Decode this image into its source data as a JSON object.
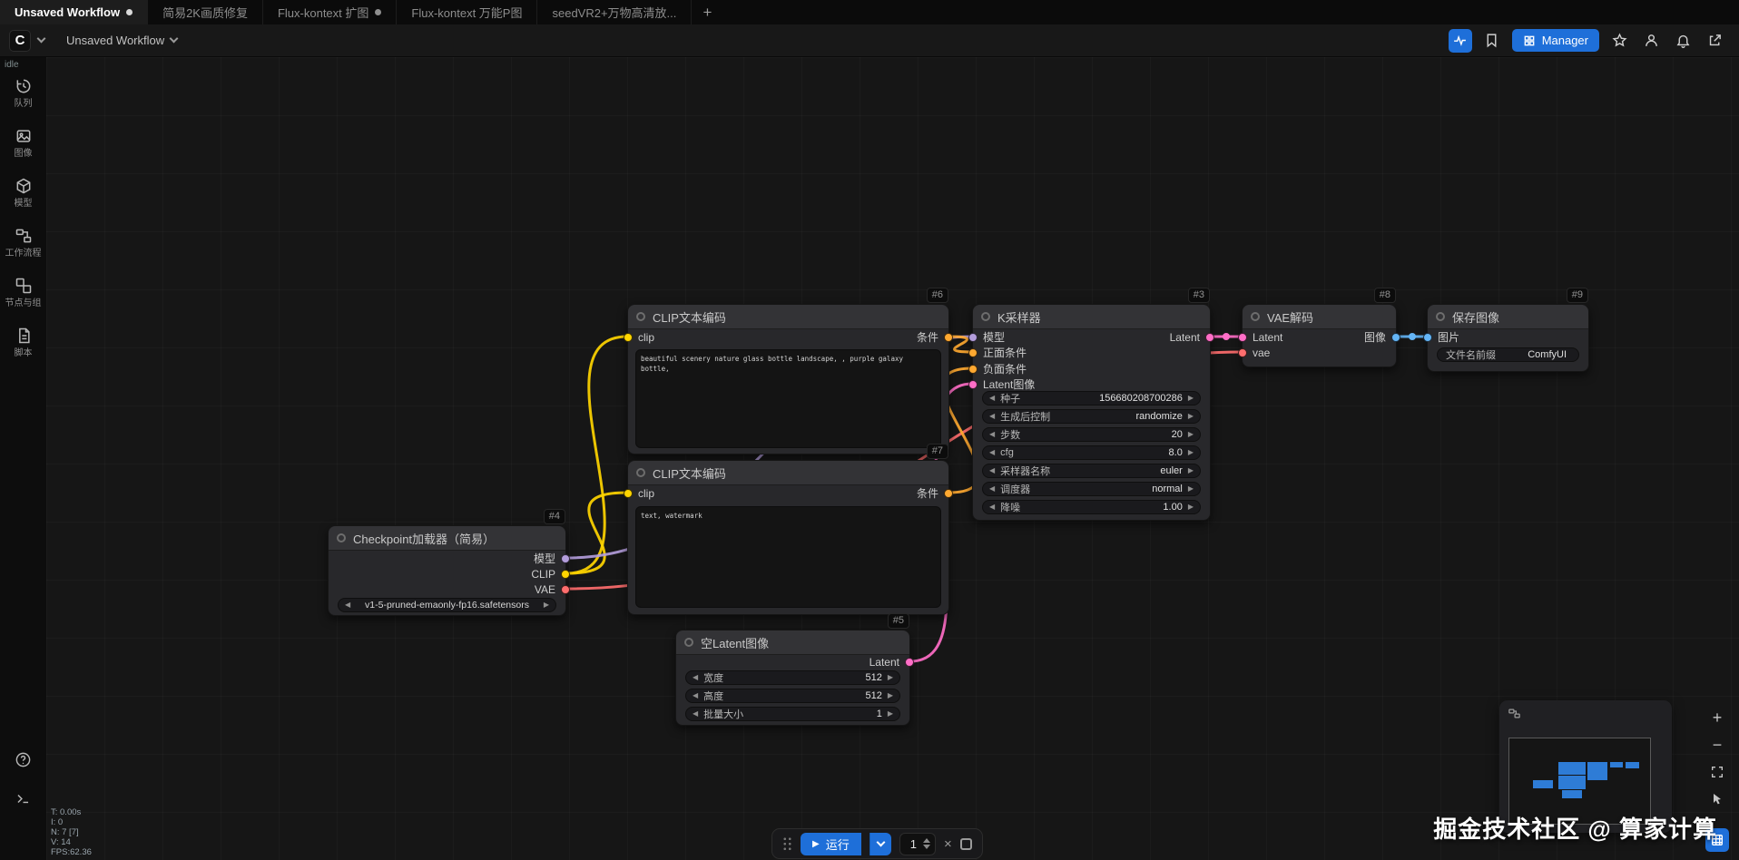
{
  "tabbar": {
    "tabs": [
      {
        "label": "Unsaved Workflow",
        "active": true,
        "dot": true
      },
      {
        "label": "简易2K画质修复",
        "active": false,
        "dot": false
      },
      {
        "label": "Flux-kontext 扩图",
        "active": false,
        "dot": true
      },
      {
        "label": "Flux-kontext 万能P图",
        "active": false,
        "dot": false
      },
      {
        "label": "seedVR2+万物高清放...",
        "active": false,
        "dot": false
      }
    ],
    "new_tab_label": "+"
  },
  "menubar": {
    "workflow_name": "Unsaved Workflow",
    "manager_label": "Manager",
    "status": "idle"
  },
  "sidebar": {
    "items": [
      {
        "label": "队列"
      },
      {
        "label": "图像"
      },
      {
        "label": "模型"
      },
      {
        "label": "工作流程"
      },
      {
        "label": "节点与组"
      },
      {
        "label": "脚本"
      }
    ]
  },
  "canvas_stats": {
    "lines": [
      "T: 0.00s",
      "I: 0",
      "N: 7 [7]",
      "V: 14",
      "FPS:62.36"
    ]
  },
  "nodes": {
    "checkpoint": {
      "badge": "#4",
      "title": "Checkpoint加载器（简易）",
      "outputs": [
        "模型",
        "CLIP",
        "VAE"
      ],
      "widget_value": "v1-5-pruned-emaonly-fp16.safetensors"
    },
    "clip_pos": {
      "badge": "#6",
      "title": "CLIP文本编码",
      "input": "clip",
      "output": "条件",
      "text": "beautiful scenery nature glass bottle landscape, , purple galaxy bottle,"
    },
    "clip_neg": {
      "badge": "#7",
      "title": "CLIP文本编码",
      "input": "clip",
      "output": "条件",
      "text": "text, watermark"
    },
    "ksampler": {
      "badge": "#3",
      "title": "K采样器",
      "inputs": [
        "模型",
        "正面条件",
        "负面条件",
        "Latent图像"
      ],
      "output": "Latent",
      "widgets": [
        {
          "label": "种子",
          "value": "156680208700286"
        },
        {
          "label": "生成后控制",
          "value": "randomize"
        },
        {
          "label": "步数",
          "value": "20"
        },
        {
          "label": "cfg",
          "value": "8.0"
        },
        {
          "label": "采样器名称",
          "value": "euler"
        },
        {
          "label": "调度器",
          "value": "normal"
        },
        {
          "label": "降噪",
          "value": "1.00"
        }
      ]
    },
    "empty_latent": {
      "badge": "#5",
      "title": "空Latent图像",
      "output": "Latent",
      "widgets": [
        {
          "label": "宽度",
          "value": "512"
        },
        {
          "label": "高度",
          "value": "512"
        },
        {
          "label": "批量大小",
          "value": "1"
        }
      ]
    },
    "vae_decode": {
      "badge": "#8",
      "title": "VAE解码",
      "inputs": [
        "Latent",
        "vae"
      ],
      "output": "图像"
    },
    "save_image": {
      "badge": "#9",
      "title": "保存图像",
      "input": "图片",
      "widget": {
        "label": "文件名前缀",
        "value": "ComfyUI"
      }
    }
  },
  "runbar": {
    "run_label": "运行",
    "count": "1"
  },
  "watermark": "掘金技术社区 @ 算家计算",
  "colors": {
    "accent_blue": "#1E6FD9",
    "model": "#B39DDB",
    "clip": "#FFD500",
    "vae": "#FF6E6E",
    "conditioning": "#FFA931",
    "latent": "#FF6EC7",
    "image": "#64B5F6"
  }
}
